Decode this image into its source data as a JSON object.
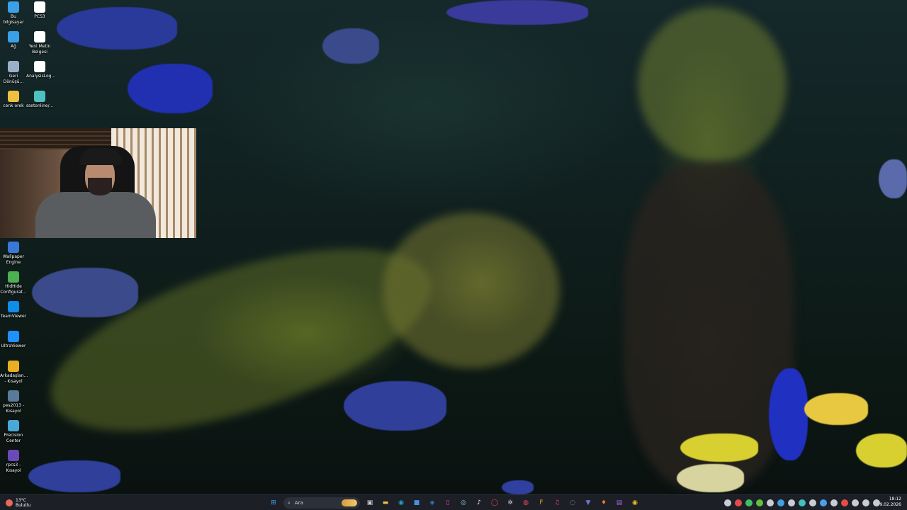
{
  "desktop": {
    "icons": [
      {
        "label": "Bu bilgisayar",
        "icon": "computer-icon",
        "color": "#3aa0e8"
      },
      {
        "label": "PCS3",
        "icon": "file-icon",
        "color": "#ffffff"
      },
      {
        "label": "Ağ",
        "icon": "network-icon",
        "color": "#3aa0e8"
      },
      {
        "label": "Yeni Metin Belgesi",
        "icon": "text-file-icon",
        "color": "#ffffff"
      },
      {
        "label": "Geri Dönüşü...",
        "icon": "recycle-bin-icon",
        "color": "#9ab0c8"
      },
      {
        "label": "AnalysisLog...",
        "icon": "file-icon",
        "color": "#ffffff"
      },
      {
        "label": "cenk orek",
        "icon": "folder-icon",
        "color": "#f0c040"
      },
      {
        "label": "ssetonline/...",
        "icon": "app-icon",
        "color": "#4fc0c0"
      },
      {
        "label": "Wallpaper Engine",
        "icon": "wallpaper-engine-icon",
        "color": "#3a78d8"
      },
      {
        "label": "HidHide Configurat...",
        "icon": "hidhide-icon",
        "color": "#4caf50"
      },
      {
        "label": "TeamViewer",
        "icon": "teamviewer-icon",
        "color": "#0e8ee9"
      },
      {
        "label": "UltraViewer",
        "icon": "ultraviewer-icon",
        "color": "#1e90ff"
      },
      {
        "label": "Arkadaşları... - Kısayol",
        "icon": "shortcut-icon",
        "color": "#e8b020"
      },
      {
        "label": "pes2013 - Kısayol",
        "icon": "game-icon",
        "color": "#5a7a9a"
      },
      {
        "label": "Precision Center",
        "icon": "precision-icon",
        "color": "#4aa8d8"
      },
      {
        "label": "rpcs3 - Kısayol",
        "icon": "rpcs3-icon",
        "color": "#6a4ab8"
      }
    ]
  },
  "taskbar": {
    "weather": {
      "temp": "13°C",
      "condition": "Bulutlu"
    },
    "search_placeholder": "Ara",
    "clock": {
      "time": "18:12",
      "date": "9.02.2026"
    },
    "apps": [
      {
        "name": "start-button",
        "color": "#3aa0e8",
        "glyph": "⊞"
      },
      {
        "name": "task-view-button",
        "color": "#c8ccd4",
        "glyph": "▣"
      },
      {
        "name": "file-explorer-button",
        "color": "#f0c040",
        "glyph": "▬"
      },
      {
        "name": "edge-button",
        "color": "#2aa0c8",
        "glyph": "◉"
      },
      {
        "name": "store-button",
        "color": "#4a90e2",
        "glyph": "■"
      },
      {
        "name": "mail-button",
        "color": "#3a7ad8",
        "glyph": "◈"
      },
      {
        "name": "app-active-button",
        "color": "#e040a0",
        "glyph": "▯"
      },
      {
        "name": "chatgpt-button",
        "color": "#8ac8e8",
        "glyph": "◎"
      },
      {
        "name": "tiktok-button",
        "color": "#ffffff",
        "glyph": "♪"
      },
      {
        "name": "opera-button",
        "color": "#e84a3a",
        "glyph": "◯"
      },
      {
        "name": "settings-button",
        "color": "#c8ccd4",
        "glyph": "✲"
      },
      {
        "name": "app-red-button",
        "color": "#e84a5a",
        "glyph": "◍"
      },
      {
        "name": "figma-button",
        "color": "#f0a020",
        "glyph": "F"
      },
      {
        "name": "capcut-button",
        "color": "#e83a6a",
        "glyph": "♫"
      },
      {
        "name": "app-gray-button",
        "color": "#a8b0bc",
        "glyph": "◌"
      },
      {
        "name": "proton-vpn-button",
        "color": "#6a7ad8",
        "glyph": "▼"
      },
      {
        "name": "brave-button",
        "color": "#f07030",
        "glyph": "♦"
      },
      {
        "name": "obs-button",
        "color": "#9a6ad8",
        "glyph": "▤"
      },
      {
        "name": "app-yellow-button",
        "color": "#f0c020",
        "glyph": "◉"
      }
    ],
    "tray_icons": [
      {
        "name": "tray-icon-1",
        "color": "#c8ccd4"
      },
      {
        "name": "tray-icon-2",
        "color": "#e84a4a"
      },
      {
        "name": "whatsapp-tray-icon",
        "color": "#40c060"
      },
      {
        "name": "xbox-tray-icon",
        "color": "#60c040"
      },
      {
        "name": "tray-icon-5",
        "color": "#c8ccd4"
      },
      {
        "name": "tray-icon-6",
        "color": "#40a0e0"
      },
      {
        "name": "tray-icon-7",
        "color": "#c8ccd4"
      },
      {
        "name": "tray-icon-8",
        "color": "#40c0c0"
      },
      {
        "name": "tray-icon-9",
        "color": "#c8ccd4"
      },
      {
        "name": "bluetooth-tray-icon",
        "color": "#4aa0e8"
      },
      {
        "name": "tray-icon-11",
        "color": "#c8ccd4"
      },
      {
        "name": "tray-icon-12",
        "color": "#e84a4a"
      },
      {
        "name": "tray-icon-13",
        "color": "#c8ccd4"
      },
      {
        "name": "network-tray-icon",
        "color": "#c8ccd4"
      },
      {
        "name": "volume-tray-icon",
        "color": "#c8ccd4"
      }
    ]
  }
}
